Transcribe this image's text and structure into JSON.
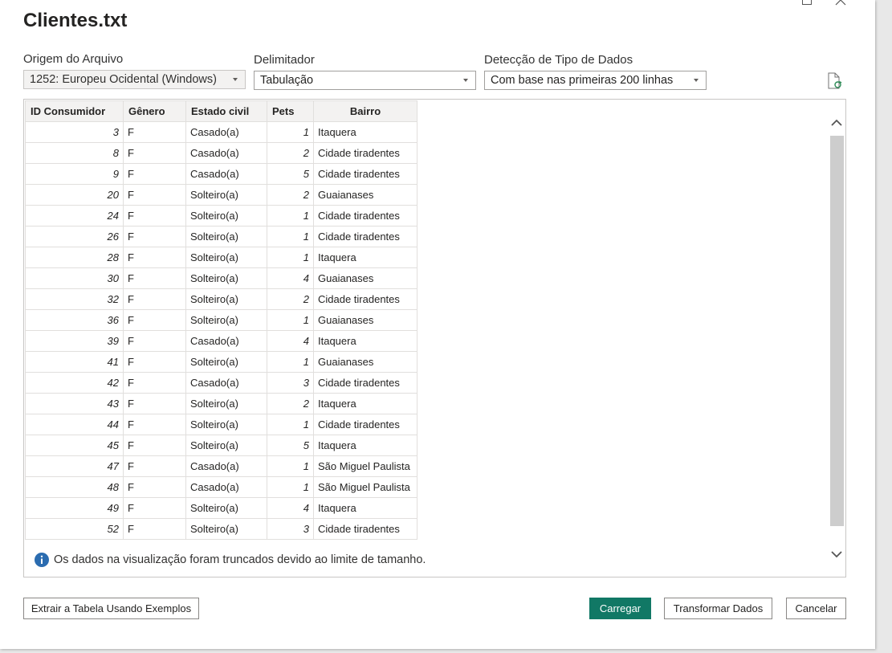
{
  "dialog": {
    "title": "Clientes.txt"
  },
  "fields": {
    "origin": {
      "label": "Origem do Arquivo",
      "value": "1252: Europeu Ocidental (Windows)"
    },
    "delimiter": {
      "label": "Delimitador",
      "value": "Tabulação"
    },
    "detection": {
      "label": "Detecção de Tipo de Dados",
      "value": "Com base nas primeiras 200 linhas"
    }
  },
  "table": {
    "columns": [
      "ID Consumidor",
      "Gênero",
      "Estado civil",
      "Pets",
      "Bairro"
    ],
    "rows": [
      [
        "3",
        "F",
        "Casado(a)",
        "1",
        "Itaquera"
      ],
      [
        "8",
        "F",
        "Casado(a)",
        "2",
        "Cidade tiradentes"
      ],
      [
        "9",
        "F",
        "Casado(a)",
        "5",
        "Cidade tiradentes"
      ],
      [
        "20",
        "F",
        "Solteiro(a)",
        "2",
        "Guaianases"
      ],
      [
        "24",
        "F",
        "Solteiro(a)",
        "1",
        "Cidade tiradentes"
      ],
      [
        "26",
        "F",
        "Solteiro(a)",
        "1",
        "Cidade tiradentes"
      ],
      [
        "28",
        "F",
        "Solteiro(a)",
        "1",
        "Itaquera"
      ],
      [
        "30",
        "F",
        "Solteiro(a)",
        "4",
        "Guaianases"
      ],
      [
        "32",
        "F",
        "Solteiro(a)",
        "2",
        "Cidade tiradentes"
      ],
      [
        "36",
        "F",
        "Solteiro(a)",
        "1",
        "Guaianases"
      ],
      [
        "39",
        "F",
        "Casado(a)",
        "4",
        "Itaquera"
      ],
      [
        "41",
        "F",
        "Solteiro(a)",
        "1",
        "Guaianases"
      ],
      [
        "42",
        "F",
        "Casado(a)",
        "3",
        "Cidade tiradentes"
      ],
      [
        "43",
        "F",
        "Solteiro(a)",
        "2",
        "Itaquera"
      ],
      [
        "44",
        "F",
        "Solteiro(a)",
        "1",
        "Cidade tiradentes"
      ],
      [
        "45",
        "F",
        "Solteiro(a)",
        "5",
        "Itaquera"
      ],
      [
        "47",
        "F",
        "Casado(a)",
        "1",
        "São Miguel Paulista"
      ],
      [
        "48",
        "F",
        "Casado(a)",
        "1",
        "São Miguel Paulista"
      ],
      [
        "49",
        "F",
        "Solteiro(a)",
        "4",
        "Itaquera"
      ],
      [
        "52",
        "F",
        "Solteiro(a)",
        "3",
        "Cidade tiradentes"
      ]
    ]
  },
  "info_message": "Os dados na visualização foram truncados devido ao limite de tamanho.",
  "buttons": {
    "extract": "Extrair a Tabela Usando Exemplos",
    "load": "Carregar",
    "transform": "Transformar Dados",
    "cancel": "Cancelar"
  },
  "colors": {
    "primary": "#117865",
    "info_icon": "#2b6cb0"
  },
  "icons": [
    "maximize-icon",
    "close-icon",
    "refresh-file-icon",
    "info-icon",
    "chevron-up-icon",
    "chevron-down-icon"
  ]
}
